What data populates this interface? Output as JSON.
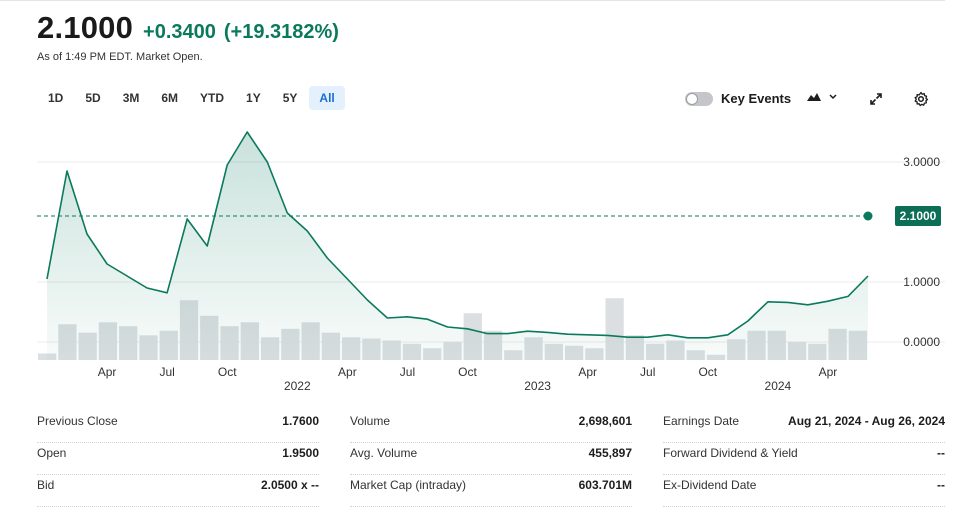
{
  "quote": {
    "price": "2.1000",
    "change": "+0.3400",
    "change_pct": "(+19.3182%)",
    "as_of": "As of 1:49 PM EDT. Market Open."
  },
  "ranges": [
    "1D",
    "5D",
    "3M",
    "6M",
    "YTD",
    "1Y",
    "5Y",
    "All"
  ],
  "active_range": "All",
  "toolbar": {
    "key_events_label": "Key Events",
    "chart_type_icon": "mountain-chart-icon",
    "expand_icon": "expand-icon",
    "settings_icon": "gear-icon"
  },
  "colors": {
    "accent": "#0b7a5c",
    "area_fill": "#d7ece5",
    "volume_bar": "#dcdfe2",
    "active_range_bg": "#e4f0fb",
    "active_range_text": "#1a6fd1"
  },
  "chart_data": {
    "type": "line",
    "title": "",
    "xlabel": "",
    "ylabel": "",
    "y_ticks": [
      "3.0000",
      "1.0000",
      "0.0000"
    ],
    "y_tick_values": [
      3.0,
      1.0,
      0.0
    ],
    "ylim": [
      -0.3,
      3.6
    ],
    "x_tick_labels": [
      "Apr",
      "Jul",
      "Oct",
      "Apr",
      "Jul",
      "Oct",
      "Apr",
      "Jul",
      "Oct",
      "Apr"
    ],
    "x_tick_months": [
      3,
      6,
      9,
      15,
      18,
      21,
      27,
      30,
      33,
      39
    ],
    "year_labels": [
      "2022",
      "2023",
      "2024"
    ],
    "year_label_months": [
      12,
      24,
      36
    ],
    "current_price_label": "2.1000",
    "current_price_value": 2.1,
    "series": [
      {
        "x_months": [
          0,
          1,
          2,
          3,
          4,
          5,
          6,
          7,
          8,
          9,
          10,
          11,
          12,
          13,
          14,
          15,
          16,
          17,
          18,
          19,
          20,
          21,
          22,
          23,
          24,
          25,
          26,
          27,
          28,
          29,
          30,
          31,
          32,
          33,
          34,
          35,
          36,
          37,
          38,
          39,
          40,
          41
        ],
        "values": [
          1.05,
          2.85,
          1.8,
          1.3,
          1.1,
          0.9,
          0.82,
          2.05,
          1.6,
          2.95,
          3.5,
          3.0,
          2.15,
          1.85,
          1.4,
          1.05,
          0.7,
          0.4,
          0.42,
          0.38,
          0.25,
          0.22,
          0.14,
          0.14,
          0.18,
          0.16,
          0.13,
          0.12,
          0.11,
          0.08,
          0.08,
          0.12,
          0.07,
          0.07,
          0.12,
          0.35,
          0.67,
          0.66,
          0.62,
          0.68,
          0.76,
          1.1,
          2.1
        ]
      }
    ],
    "volume_relative": [
      0.1,
      0.55,
      0.42,
      0.58,
      0.52,
      0.38,
      0.45,
      0.92,
      0.68,
      0.52,
      0.58,
      0.35,
      0.48,
      0.58,
      0.42,
      0.35,
      0.33,
      0.3,
      0.25,
      0.18,
      0.28,
      0.72,
      0.45,
      0.15,
      0.35,
      0.25,
      0.22,
      0.18,
      0.95,
      0.38,
      0.25,
      0.3,
      0.15,
      0.08,
      0.32,
      0.45,
      0.45,
      0.28,
      0.25,
      0.48,
      0.45
    ]
  },
  "stats": {
    "col1": [
      {
        "label": "Previous Close",
        "value": "1.7600"
      },
      {
        "label": "Open",
        "value": "1.9500"
      },
      {
        "label": "Bid",
        "value": "2.0500 x --"
      }
    ],
    "col2": [
      {
        "label": "Volume",
        "value": "2,698,601"
      },
      {
        "label": "Avg. Volume",
        "value": "455,897"
      },
      {
        "label": "Market Cap (intraday)",
        "value": "603.701M"
      }
    ],
    "col3": [
      {
        "label": "Earnings Date",
        "value": "Aug 21, 2024 - Aug 26, 2024"
      },
      {
        "label": "Forward Dividend & Yield",
        "value": "--"
      },
      {
        "label": "Ex-Dividend Date",
        "value": "--"
      }
    ]
  }
}
